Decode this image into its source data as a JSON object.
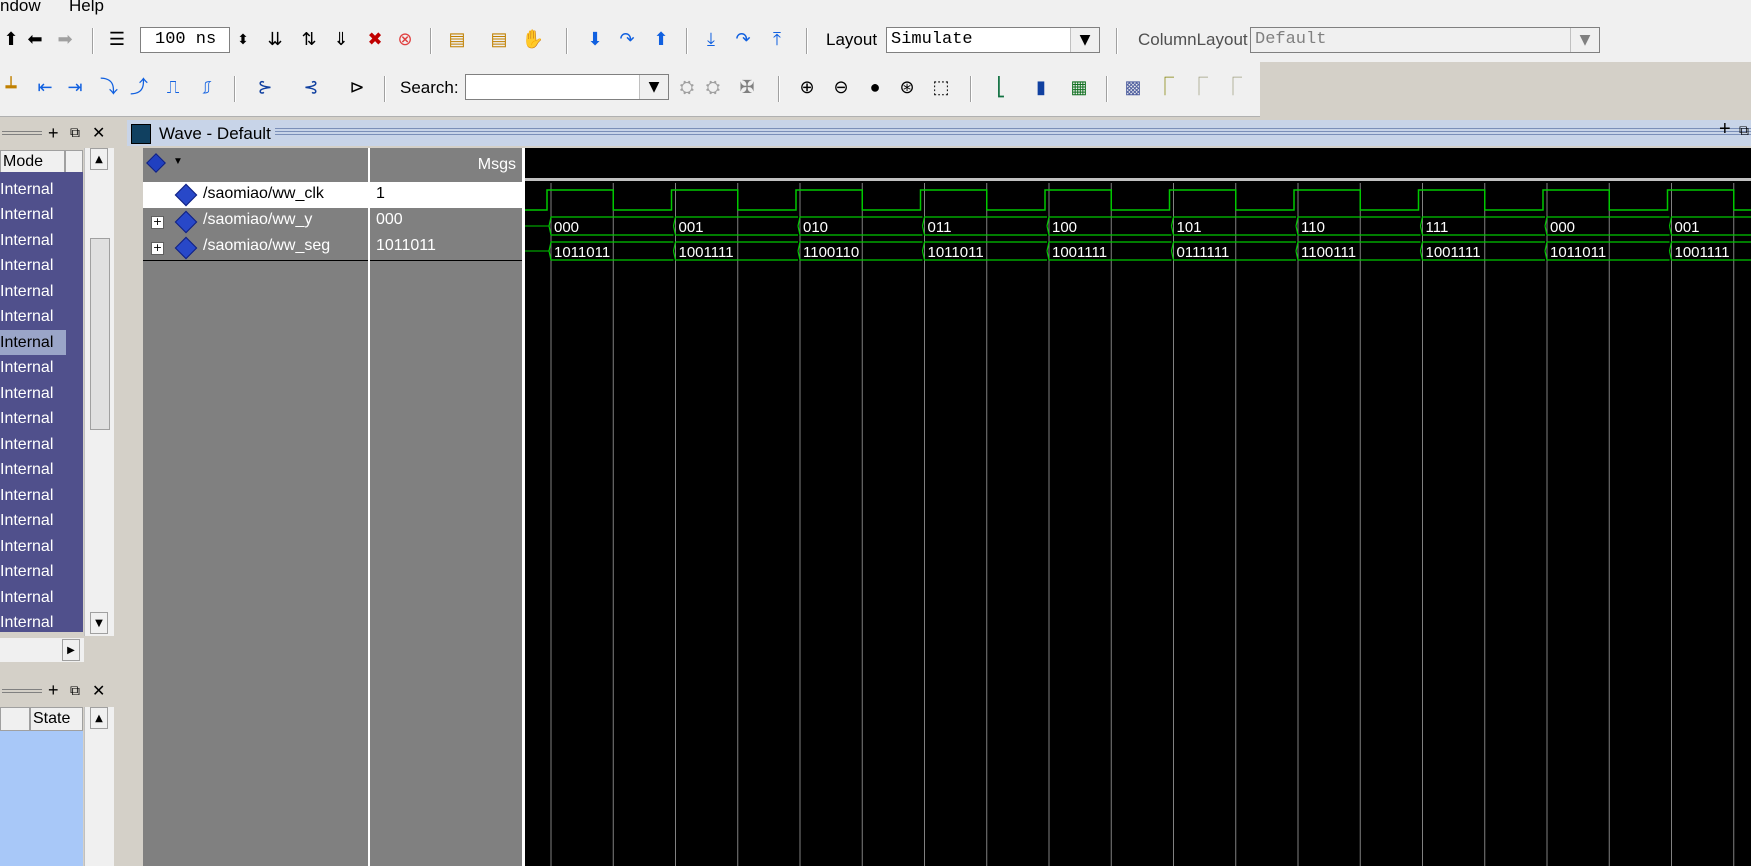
{
  "menu": {
    "items": [
      "ndow",
      "Help"
    ]
  },
  "toolbar": {
    "time_value": "100 ns",
    "layout_label": "Layout",
    "layout_value": "Simulate",
    "column_layout_label": "ColumnLayout",
    "column_layout_value": "Default",
    "search_label": "Search:"
  },
  "left_panel": {
    "mode_header": "Mode",
    "mode_items": [
      "Internal",
      "Internal",
      "Internal",
      "Internal",
      "Internal",
      "Internal",
      "Internal",
      "Internal",
      "Internal",
      "Internal",
      "Internal",
      "Internal",
      "Internal",
      "Internal",
      "Internal",
      "Internal",
      "Internal",
      "Internal"
    ],
    "selected_index": 6,
    "state_header": "State"
  },
  "wave": {
    "title": "Wave - Default",
    "msgs_header": "Msgs",
    "signals": [
      {
        "name": "/saomiao/ww_clk",
        "value": "1",
        "expandable": false
      },
      {
        "name": "/saomiao/ww_y",
        "value": "000",
        "expandable": true
      },
      {
        "name": "/saomiao/ww_seg",
        "value": "1011011",
        "expandable": true
      }
    ],
    "y_values": [
      "000",
      "001",
      "010",
      "011",
      "100",
      "101",
      "110",
      "111",
      "000",
      "001"
    ],
    "seg_values": [
      "1011011",
      "1001111",
      "1100110",
      "1011011",
      "1001111",
      "0111111",
      "1100111",
      "1001111",
      "1011011",
      "1001111"
    ],
    "colors": {
      "wave_green": "#00c800",
      "grid": "#808080",
      "bus_text": "#ffffff"
    }
  }
}
